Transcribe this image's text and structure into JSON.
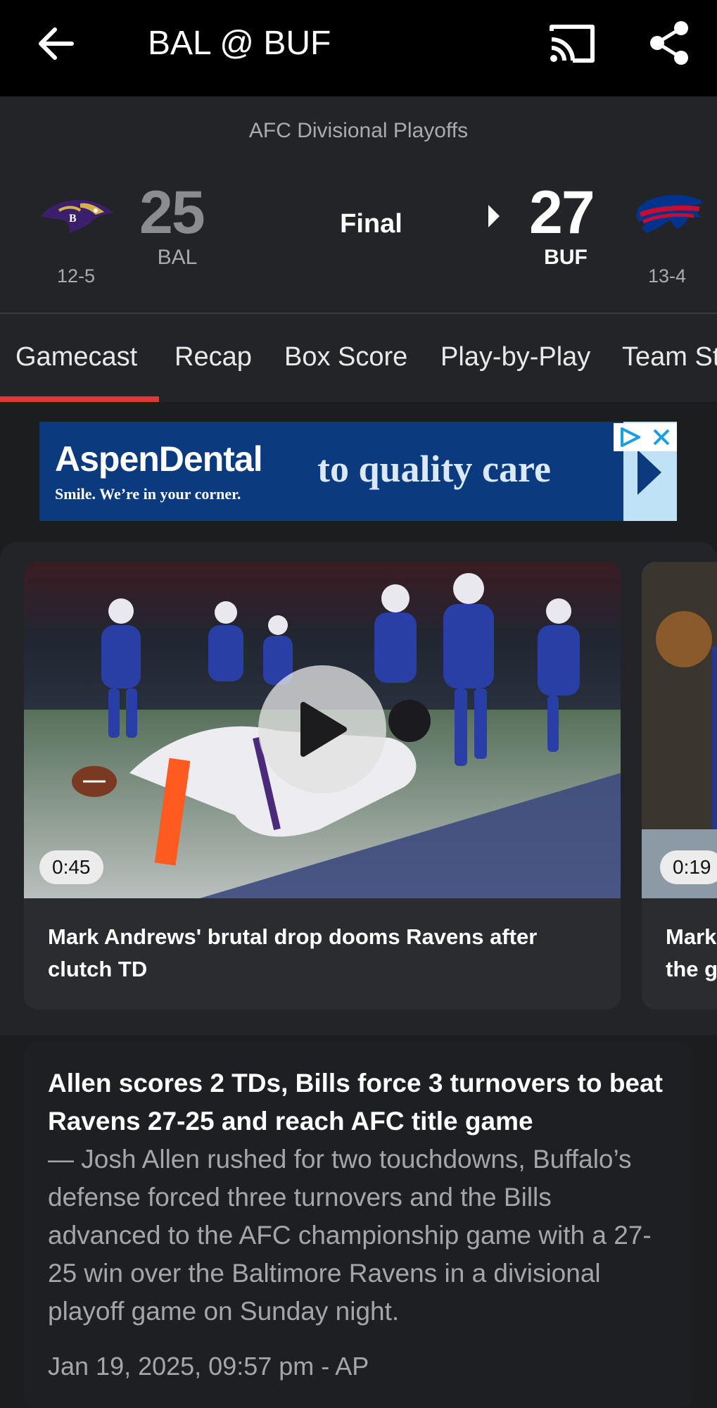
{
  "header": {
    "title": "BAL @ BUF",
    "back_icon": "arrow-left-icon",
    "cast_icon": "cast-icon",
    "share_icon": "share-icon"
  },
  "game": {
    "round": "AFC Divisional Playoffs",
    "status": "Final",
    "away": {
      "abbr": "BAL",
      "score": "25",
      "record": "12-5",
      "logo": "ravens-logo",
      "color": "#8a8c90"
    },
    "home": {
      "abbr": "BUF",
      "score": "27",
      "record": "13-4",
      "logo": "bills-logo",
      "color": "#ffffff"
    }
  },
  "tabs": [
    {
      "label": "Gamecast",
      "active": true
    },
    {
      "label": "Recap"
    },
    {
      "label": "Box Score"
    },
    {
      "label": "Play-by-Play"
    },
    {
      "label": "Team St"
    }
  ],
  "ad": {
    "brand": "AspenDental",
    "tagline": "Smile. We’re in your corner.",
    "headline": "to quality care",
    "colors": {
      "background": "#0b3a7e",
      "accent": "#bfe2f7"
    }
  },
  "videos": [
    {
      "duration": "0:45",
      "title": "Mark Andrews' brutal drop dooms Ravens after clutch TD"
    },
    {
      "duration": "0:19",
      "title": "Mark",
      "title_line2": "the g"
    }
  ],
  "article": {
    "headline": "Allen scores 2 TDs, Bills force 3 turnovers to beat Ravens 27-25 and reach AFC title game",
    "body": "— Josh Allen rushed for two touchdowns, Buffalo’s defense forced three turnovers and the Bills advanced to the AFC championship game with a 27-25 win over the Baltimore Ravens in a divisional playoff game on Sunday night.",
    "meta": "Jan 19, 2025, 09:57 pm - AP"
  },
  "colors": {
    "accent": "#e03a2d",
    "background": "#1c1d1f"
  }
}
